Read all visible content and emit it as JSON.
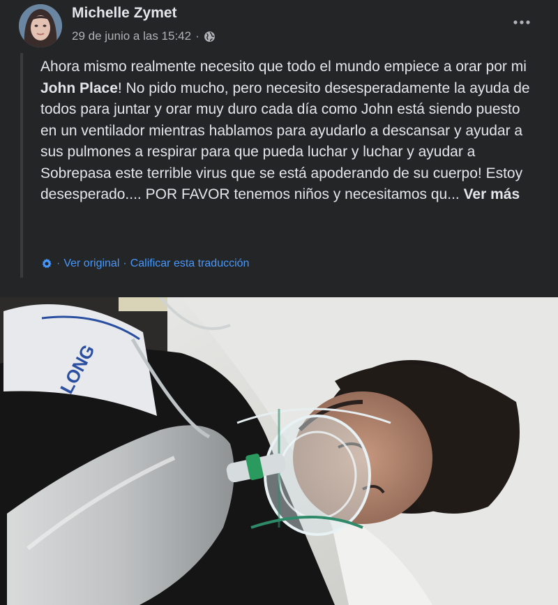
{
  "post": {
    "author": "Michelle Zymet",
    "timestamp": "29 de junio a las 15:42",
    "separator": "·",
    "privacy_icon": "globe-icon",
    "menu_icon": "more-options-icon",
    "body": {
      "part1": "Ahora mismo realmente necesito que todo el mundo empiece a orar por mi ",
      "mention": "John Place",
      "part2": "! No pido mucho, pero necesito desesperadamente la ayuda de todos para juntar y orar muy duro cada día como John está siendo puesto en un ventilador mientras hablamos para ayudarlo a descansar y ayudar a sus pulmones a respirar para que pueda luchar y luchar y ayudar a Sobrepasa este terrible virus que se está apoderando de su cuerpo! Estoy desesperado.... POR FAVOR tenemos niños y necesitamos qu... ",
      "see_more": "Ver más"
    },
    "translation": {
      "icon": "settings-gear-icon",
      "view_original": "Ver original",
      "rate_translation": "Calificar esta traducción"
    },
    "photo": {
      "cuff_text": "LONG"
    }
  },
  "colors": {
    "background": "#242526",
    "text": "#e4e6eb",
    "secondary_text": "#b0b3b8",
    "link": "#4599ff"
  }
}
